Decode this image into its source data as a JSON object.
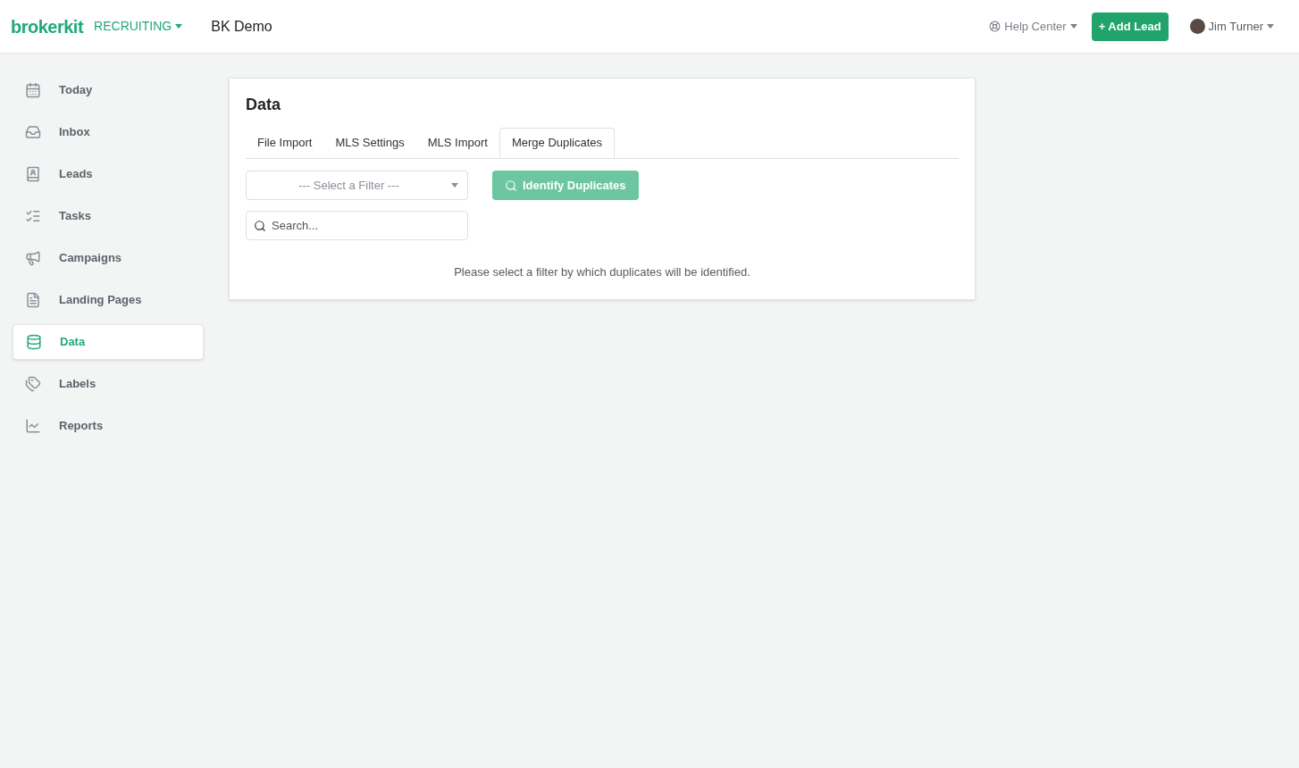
{
  "header": {
    "logo": "brokerkit",
    "product_menu": "RECRUITING",
    "account": "BK Demo",
    "help": "Help Center",
    "add_button": "+ Add Lead",
    "user": "Jim Turner"
  },
  "sidebar": {
    "items": [
      {
        "label": "Today",
        "selected": false
      },
      {
        "label": "Inbox",
        "selected": false
      },
      {
        "label": "Leads",
        "selected": false
      },
      {
        "label": "Tasks",
        "selected": false
      },
      {
        "label": "Campaigns",
        "selected": false
      },
      {
        "label": "Landing Pages",
        "selected": false
      },
      {
        "label": "Data",
        "selected": true
      },
      {
        "label": "Labels",
        "selected": false
      },
      {
        "label": "Reports",
        "selected": false
      }
    ]
  },
  "panel": {
    "title": "Data",
    "tabs": [
      {
        "label": "File Import",
        "selected": false
      },
      {
        "label": "MLS Settings",
        "selected": false
      },
      {
        "label": "MLS Import",
        "selected": false
      },
      {
        "label": "Merge Duplicates",
        "selected": true
      }
    ],
    "filter": {
      "placeholder": "--- Select a Filter ---"
    },
    "identify_button": {
      "label": "Identify Duplicates",
      "disabled": true
    },
    "search": {
      "placeholder": "Search..."
    },
    "message": "Please select a filter by which duplicates will be identified."
  }
}
